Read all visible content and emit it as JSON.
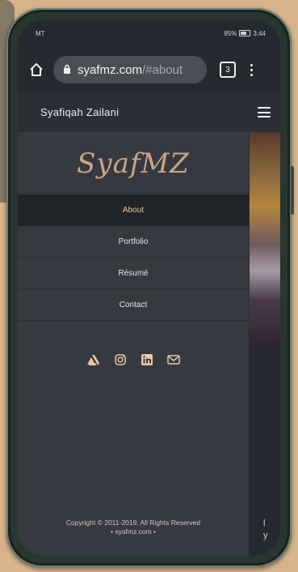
{
  "status": {
    "carrier": "MT",
    "battery": "85%",
    "time": "3:44"
  },
  "browser": {
    "url_host": "syafmz.com",
    "url_path": "/#about",
    "tab_count": "3"
  },
  "site": {
    "name": "Syafiqah Zailani",
    "logo_text": "SyafMZ"
  },
  "nav": {
    "items": [
      {
        "label": "About",
        "active": true
      },
      {
        "label": "Portfolio",
        "active": false
      },
      {
        "label": "Résumé",
        "active": false
      },
      {
        "label": "Contact",
        "active": false
      }
    ]
  },
  "social": [
    "artstation-icon",
    "instagram-icon",
    "linkedin-icon",
    "email-icon"
  ],
  "footer": {
    "copyright": "Copyright © 2011-2019. All Rights Reserved",
    "domain": "• syafmz.com •"
  },
  "background": {
    "partial_text_1": "l",
    "partial_text_2": "y"
  },
  "colors": {
    "accent": "#c9a585",
    "panel": "#363a40",
    "active_bg": "#212427"
  }
}
